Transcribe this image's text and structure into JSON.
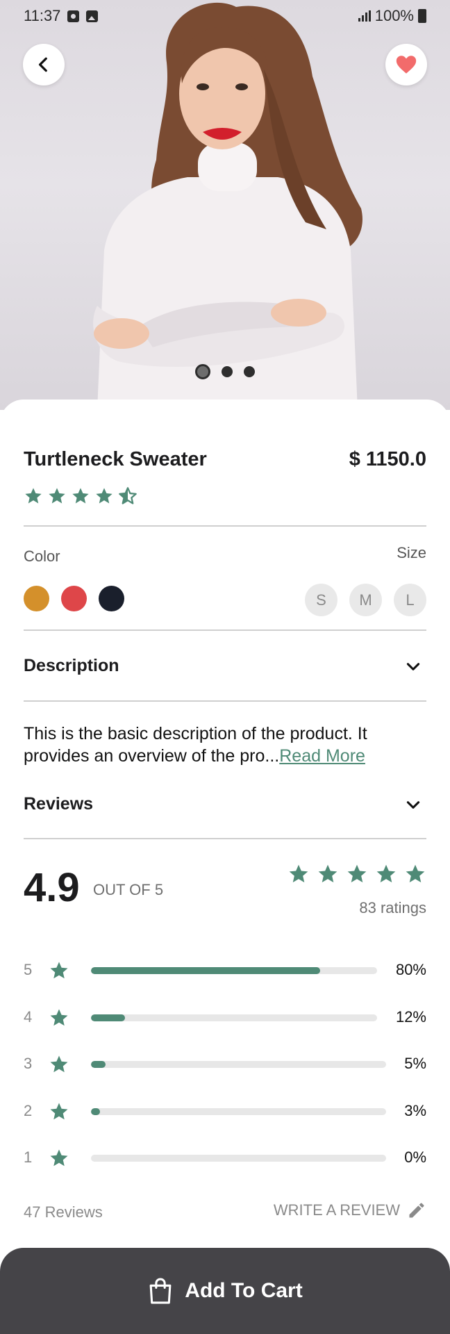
{
  "status_bar": {
    "time": "11:37",
    "battery": "100%"
  },
  "hero": {
    "carousel_pages": 3,
    "active_page": 1
  },
  "product": {
    "name": "Turtleneck Sweater",
    "price": "$ 1150.0",
    "rating_stars": 4.5
  },
  "color": {
    "label": "Color",
    "swatches": [
      "#d4902b",
      "#de4649",
      "#1a1f2c"
    ]
  },
  "size": {
    "label": "Size",
    "options": [
      "S",
      "M",
      "L"
    ]
  },
  "description": {
    "title": "Description",
    "text": "This is the basic description of the product. It provides an overview of the pro...",
    "read_more": "Read More"
  },
  "reviews": {
    "title": "Reviews",
    "average": "4.9",
    "out_of": "OUT OF 5",
    "stars": 5,
    "ratings_count": "83 ratings",
    "breakdown": [
      {
        "stars": "5",
        "percent": 80,
        "label": "80%"
      },
      {
        "stars": "4",
        "percent": 12,
        "label": "12%"
      },
      {
        "stars": "3",
        "percent": 5,
        "label": "5%"
      },
      {
        "stars": "2",
        "percent": 3,
        "label": "3%"
      },
      {
        "stars": "1",
        "percent": 0,
        "label": "0%"
      }
    ],
    "total_reviews": "47 Reviews",
    "write_review": "WRITE A REVIEW"
  },
  "cart": {
    "label": "Add To Cart"
  },
  "colors": {
    "accent": "#4f8a76",
    "cart_bg": "#454448",
    "heart": "#f26b6b"
  }
}
